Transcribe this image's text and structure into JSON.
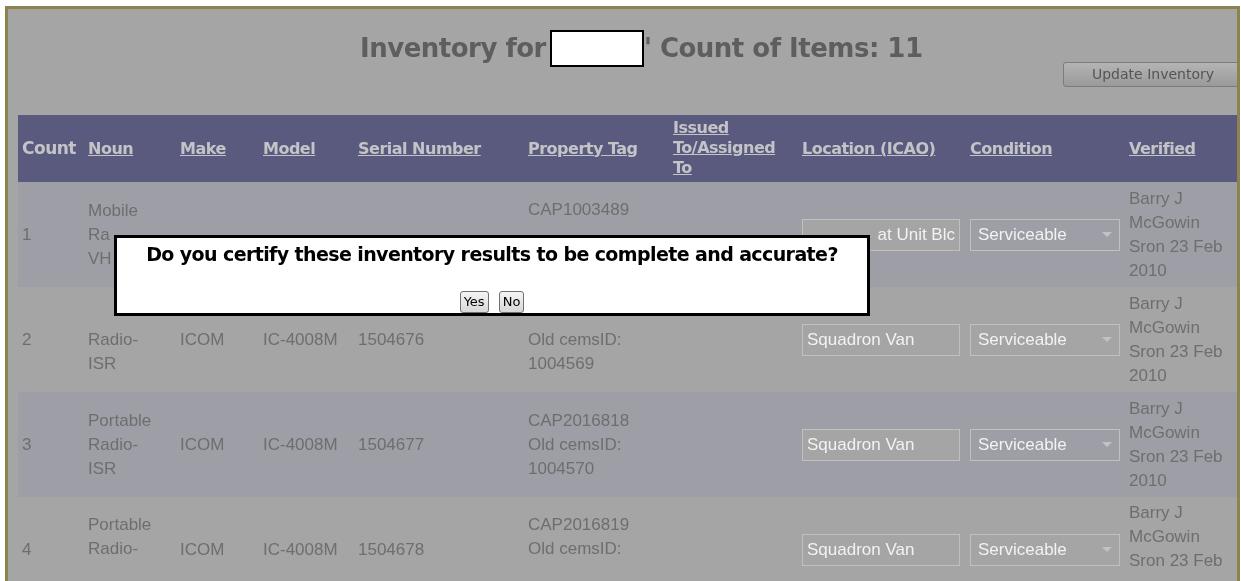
{
  "page": {
    "title_prefix": "Inventory for",
    "title_suffix": "' Count of Items: 11",
    "update_button": "Update Inventory"
  },
  "table": {
    "columns": [
      {
        "label": "Count",
        "kind": "plain"
      },
      {
        "label": "Noun",
        "kind": "link"
      },
      {
        "label": "Make",
        "kind": "link"
      },
      {
        "label": "Model",
        "kind": "link"
      },
      {
        "label": "Serial Number",
        "kind": "link"
      },
      {
        "label": "Property Tag",
        "kind": "link"
      },
      {
        "label": "Issued To/Assigned To",
        "kind": "link"
      },
      {
        "label": "Location (ICAO)",
        "kind": "link"
      },
      {
        "label": "Condition",
        "kind": "link"
      },
      {
        "label": "Verified",
        "kind": "link"
      }
    ],
    "rows": [
      {
        "cells": [
          {
            "kind": "text",
            "lines": [
              "1"
            ]
          },
          {
            "kind": "text",
            "lines": [
              "Mobile",
              "Ra",
              "VH"
            ]
          },
          {
            "kind": "blank"
          },
          {
            "kind": "blank"
          },
          {
            "kind": "blank"
          },
          {
            "kind": "text",
            "lines": [
              "CAP1003489"
            ],
            "hidden_below": true
          },
          {
            "kind": "blank"
          },
          {
            "kind": "input",
            "value": "at Unit Blc"
          },
          {
            "kind": "select",
            "value": "Serviceable"
          },
          {
            "kind": "text",
            "lines": [
              "Barry J",
              "McGowin",
              "Sron 23 Feb",
              "2010"
            ]
          }
        ]
      },
      {
        "cells": [
          {
            "kind": "text",
            "lines": [
              "2"
            ]
          },
          {
            "kind": "text",
            "lines": [
              "Radio-",
              "ISR"
            ],
            "hidden_above": true
          },
          {
            "kind": "text",
            "lines": [
              "ICOM"
            ]
          },
          {
            "kind": "text",
            "lines": [
              "IC-4008M"
            ]
          },
          {
            "kind": "text",
            "lines": [
              "1504676"
            ]
          },
          {
            "kind": "text",
            "lines": [
              "Old cemsID:",
              "1004569"
            ],
            "hidden_above": true
          },
          {
            "kind": "blank"
          },
          {
            "kind": "input",
            "value": "Squadron Van"
          },
          {
            "kind": "select",
            "value": "Serviceable"
          },
          {
            "kind": "text",
            "lines": [
              "Barry J",
              "McGowin",
              "Sron 23 Feb",
              "2010"
            ]
          }
        ]
      },
      {
        "cells": [
          {
            "kind": "text",
            "lines": [
              "3"
            ]
          },
          {
            "kind": "text",
            "lines": [
              "Portable",
              "Radio-",
              "ISR"
            ]
          },
          {
            "kind": "text",
            "lines": [
              "ICOM"
            ]
          },
          {
            "kind": "text",
            "lines": [
              "IC-4008M"
            ]
          },
          {
            "kind": "text",
            "lines": [
              "1504677"
            ]
          },
          {
            "kind": "text",
            "lines": [
              "CAP2016818",
              "Old cemsID:",
              "1004570"
            ]
          },
          {
            "kind": "blank"
          },
          {
            "kind": "input",
            "value": "Squadron Van"
          },
          {
            "kind": "select",
            "value": "Serviceable"
          },
          {
            "kind": "text",
            "lines": [
              "Barry J",
              "McGowin",
              "Sron 23 Feb",
              "2010"
            ]
          }
        ]
      },
      {
        "cells": [
          {
            "kind": "text",
            "lines": [
              "4"
            ]
          },
          {
            "kind": "text",
            "lines": [
              "Portable",
              "Radio-"
            ],
            "hidden_below": true
          },
          {
            "kind": "text",
            "lines": [
              "ICOM"
            ]
          },
          {
            "kind": "text",
            "lines": [
              "IC-4008M"
            ]
          },
          {
            "kind": "text",
            "lines": [
              "1504678"
            ]
          },
          {
            "kind": "text",
            "lines": [
              "CAP2016819",
              "Old cemsID:"
            ],
            "hidden_below": true
          },
          {
            "kind": "blank"
          },
          {
            "kind": "input",
            "value": "Squadron Van"
          },
          {
            "kind": "select",
            "value": "Serviceable"
          },
          {
            "kind": "text",
            "lines": [
              "Barry J",
              "McGowin",
              "Sron 23 Feb"
            ],
            "hidden_below": true
          }
        ]
      }
    ]
  },
  "dialog": {
    "message": "Do you certify these inventory results to be complete and accurate?",
    "buttons": [
      "Yes",
      "No"
    ]
  }
}
